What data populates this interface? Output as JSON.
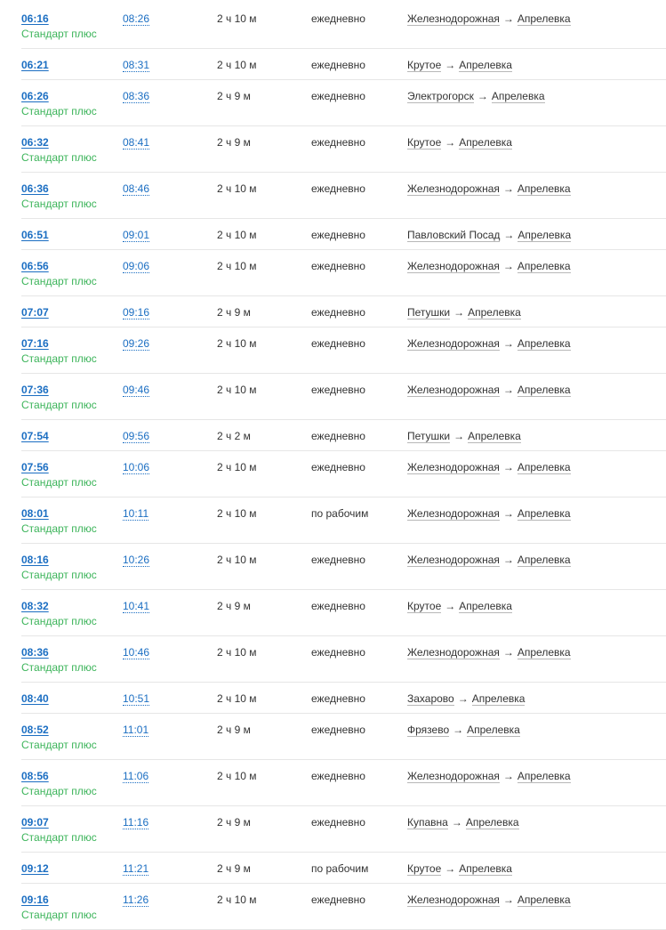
{
  "rows": [
    {
      "dep": "06:16",
      "type": "Стандарт плюс",
      "arr": "08:26",
      "dur": "2 ч 10 м",
      "days": "ежедневно",
      "from": "Железнодорожная",
      "to": "Апрелевка"
    },
    {
      "dep": "06:21",
      "type": "",
      "arr": "08:31",
      "dur": "2 ч 10 м",
      "days": "ежедневно",
      "from": "Крутое",
      "to": "Апрелевка"
    },
    {
      "dep": "06:26",
      "type": "Стандарт плюс",
      "arr": "08:36",
      "dur": "2 ч 9 м",
      "days": "ежедневно",
      "from": "Электрогорск",
      "to": "Апрелевка"
    },
    {
      "dep": "06:32",
      "type": "Стандарт плюс",
      "arr": "08:41",
      "dur": "2 ч 9 м",
      "days": "ежедневно",
      "from": "Крутое",
      "to": "Апрелевка"
    },
    {
      "dep": "06:36",
      "type": "Стандарт плюс",
      "arr": "08:46",
      "dur": "2 ч 10 м",
      "days": "ежедневно",
      "from": "Железнодорожная",
      "to": "Апрелевка"
    },
    {
      "dep": "06:51",
      "type": "",
      "arr": "09:01",
      "dur": "2 ч 10 м",
      "days": "ежедневно",
      "from": "Павловский Посад",
      "to": "Апрелевка"
    },
    {
      "dep": "06:56",
      "type": "Стандарт плюс",
      "arr": "09:06",
      "dur": "2 ч 10 м",
      "days": "ежедневно",
      "from": "Железнодорожная",
      "to": "Апрелевка"
    },
    {
      "dep": "07:07",
      "type": "",
      "arr": "09:16",
      "dur": "2 ч 9 м",
      "days": "ежедневно",
      "from": "Петушки",
      "to": "Апрелевка"
    },
    {
      "dep": "07:16",
      "type": "Стандарт плюс",
      "arr": "09:26",
      "dur": "2 ч 10 м",
      "days": "ежедневно",
      "from": "Железнодорожная",
      "to": "Апрелевка"
    },
    {
      "dep": "07:36",
      "type": "Стандарт плюс",
      "arr": "09:46",
      "dur": "2 ч 10 м",
      "days": "ежедневно",
      "from": "Железнодорожная",
      "to": "Апрелевка"
    },
    {
      "dep": "07:54",
      "type": "",
      "arr": "09:56",
      "dur": "2 ч 2 м",
      "days": "ежедневно",
      "from": "Петушки",
      "to": "Апрелевка"
    },
    {
      "dep": "07:56",
      "type": "Стандарт плюс",
      "arr": "10:06",
      "dur": "2 ч 10 м",
      "days": "ежедневно",
      "from": "Железнодорожная",
      "to": "Апрелевка"
    },
    {
      "dep": "08:01",
      "type": "Стандарт плюс",
      "arr": "10:11",
      "dur": "2 ч 10 м",
      "days": "по рабочим",
      "from": "Железнодорожная",
      "to": "Апрелевка"
    },
    {
      "dep": "08:16",
      "type": "Стандарт плюс",
      "arr": "10:26",
      "dur": "2 ч 10 м",
      "days": "ежедневно",
      "from": "Железнодорожная",
      "to": "Апрелевка"
    },
    {
      "dep": "08:32",
      "type": "Стандарт плюс",
      "arr": "10:41",
      "dur": "2 ч 9 м",
      "days": "ежедневно",
      "from": "Крутое",
      "to": "Апрелевка"
    },
    {
      "dep": "08:36",
      "type": "Стандарт плюс",
      "arr": "10:46",
      "dur": "2 ч 10 м",
      "days": "ежедневно",
      "from": "Железнодорожная",
      "to": "Апрелевка"
    },
    {
      "dep": "08:40",
      "type": "",
      "arr": "10:51",
      "dur": "2 ч 10 м",
      "days": "ежедневно",
      "from": "Захарово",
      "to": "Апрелевка"
    },
    {
      "dep": "08:52",
      "type": "Стандарт плюс",
      "arr": "11:01",
      "dur": "2 ч 9 м",
      "days": "ежедневно",
      "from": "Фрязево",
      "to": "Апрелевка"
    },
    {
      "dep": "08:56",
      "type": "Стандарт плюс",
      "arr": "11:06",
      "dur": "2 ч 10 м",
      "days": "ежедневно",
      "from": "Железнодорожная",
      "to": "Апрелевка"
    },
    {
      "dep": "09:07",
      "type": "Стандарт плюс",
      "arr": "11:16",
      "dur": "2 ч 9 м",
      "days": "ежедневно",
      "from": "Купавна",
      "to": "Апрелевка"
    },
    {
      "dep": "09:12",
      "type": "",
      "arr": "11:21",
      "dur": "2 ч 9 м",
      "days": "по рабочим",
      "from": "Крутое",
      "to": "Апрелевка"
    },
    {
      "dep": "09:16",
      "type": "Стандарт плюс",
      "arr": "11:26",
      "dur": "2 ч 10 м",
      "days": "ежедневно",
      "from": "Железнодорожная",
      "to": "Апрелевка"
    }
  ],
  "route_arrow": "→",
  "colors": {
    "link": "#1b6ec2",
    "train_type": "#3cb45a",
    "text": "#333333",
    "divider": "#e6e6e6"
  }
}
